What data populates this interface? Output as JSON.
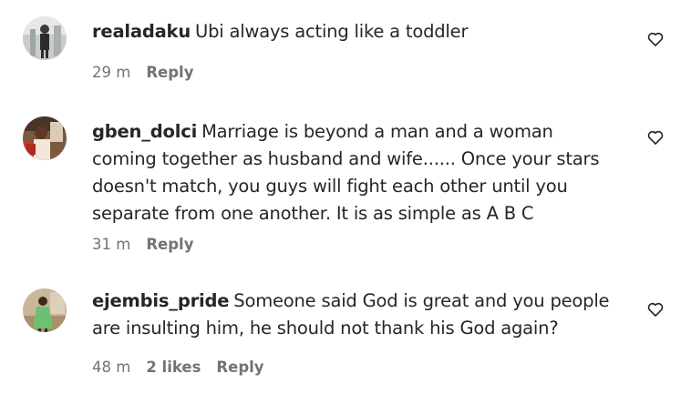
{
  "comments": [
    {
      "username": "realadaku",
      "text": "Ubi always acting like a toddler",
      "time": "29 m",
      "likes": "",
      "reply_label": "Reply",
      "avatar_icon": "avatar-photo"
    },
    {
      "username": "gben_dolci",
      "text": "Marriage is beyond a man and a woman coming together as husband and wife...... Once your stars doesn't match, you guys will fight each other until you separate from one another. It is as simple as A B C",
      "time": "31 m",
      "likes": "",
      "reply_label": "Reply",
      "avatar_icon": "avatar-photo"
    },
    {
      "username": "ejembis_pride",
      "text": "Someone said God is great and you people are insulting him, he should not thank his God again?",
      "time": "48 m",
      "likes": "2 likes",
      "reply_label": "Reply",
      "avatar_icon": "avatar-photo"
    }
  ],
  "icons": {
    "like": "heart-outline-icon"
  },
  "colors": {
    "text": "#262626",
    "meta": "#737373",
    "background": "#ffffff"
  }
}
